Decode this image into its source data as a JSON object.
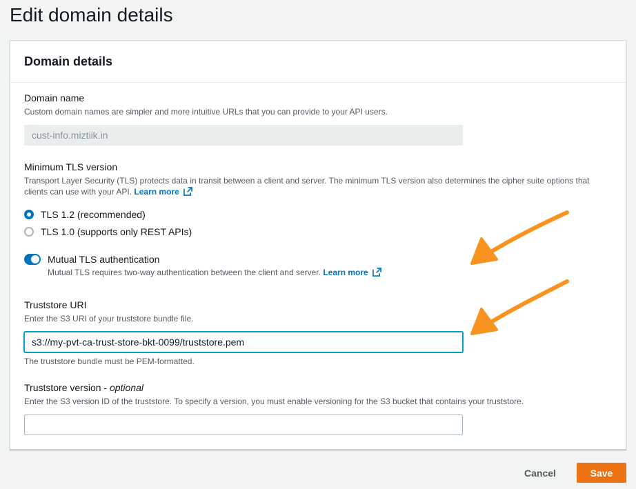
{
  "page": {
    "title": "Edit domain details"
  },
  "panel": {
    "title": "Domain details"
  },
  "domain_name": {
    "label": "Domain name",
    "description": "Custom domain names are simpler and more intuitive URLs that you can provide to your API users.",
    "value": "cust-info.miztiik.in"
  },
  "tls": {
    "label": "Minimum TLS version",
    "description_line1": "Transport Layer Security (TLS) protects data in transit between a client and server. The minimum TLS version also determines the cipher suite options that",
    "description_line2": "clients can use with your API.",
    "learn_more": "Learn more",
    "options": [
      {
        "label": "TLS 1.2 (recommended)",
        "selected": true
      },
      {
        "label": "TLS 1.0 (supports only REST APIs)",
        "selected": false
      }
    ]
  },
  "mutual_tls": {
    "label": "Mutual TLS authentication",
    "enabled": true,
    "description": "Mutual TLS requires two-way authentication between the client and server.",
    "learn_more": "Learn more"
  },
  "truststore_uri": {
    "label": "Truststore URI",
    "description": "Enter the S3 URI of your truststore bundle file.",
    "value": "s3://my-pvt-ca-trust-store-bkt-0099/truststore.pem",
    "hint": "The truststore bundle must be PEM-formatted."
  },
  "truststore_version": {
    "label": "Truststore version",
    "label_suffix": "optional",
    "description": "Enter the S3 version ID of the truststore. To specify a version, you must enable versioning for the S3 bucket that contains your truststore.",
    "value": ""
  },
  "footer": {
    "cancel_label": "Cancel",
    "save_label": "Save"
  },
  "colors": {
    "primary": "#ec7211",
    "link": "#0073bb",
    "annotation_arrow": "#f7931e"
  },
  "icons": {
    "external_link": "external-link-icon",
    "annotation": "arrow-icon"
  }
}
